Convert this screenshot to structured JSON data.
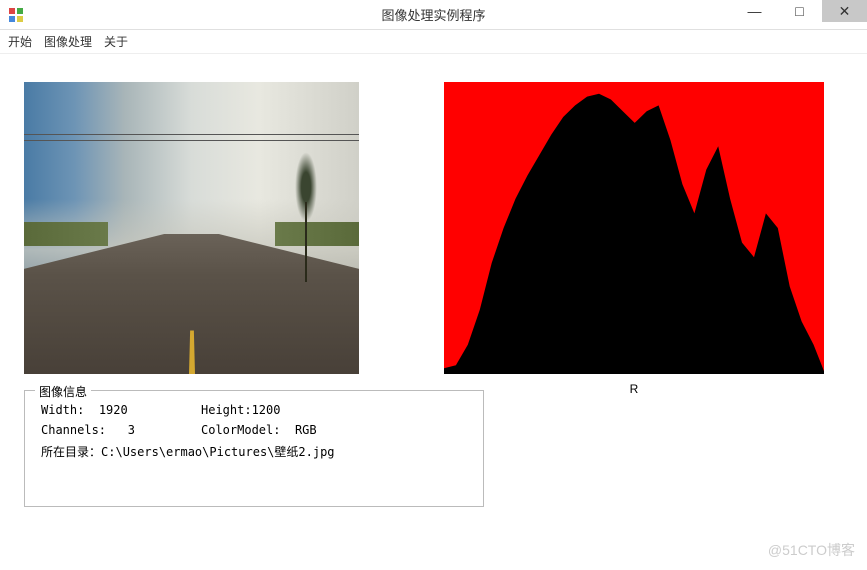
{
  "window": {
    "title": "图像处理实例程序",
    "controls": {
      "min": "—",
      "max": "□",
      "close": "✕"
    }
  },
  "menu": {
    "start": "开始",
    "imageProcess": "图像处理",
    "about": "关于"
  },
  "histogram": {
    "label": "R"
  },
  "info": {
    "legend": "图像信息",
    "widthLabel": "Width:",
    "widthValue": "1920",
    "heightLabel": "Height:",
    "heightValue": "1200",
    "channelsLabel": "Channels:",
    "channelsValue": "3",
    "colorModelLabel": "ColorModel:",
    "colorModelValue": "RGB",
    "dirLabel": "所在目录：",
    "dirValue": "C:\\Users\\ermao\\Pictures\\壁纸2.jpg"
  },
  "watermark": "@51CTO博客",
  "chart_data": {
    "type": "area",
    "title": "R",
    "xlabel": "",
    "ylabel": "",
    "xlim": [
      0,
      255
    ],
    "ylim": [
      0,
      1
    ],
    "x": [
      0,
      8,
      16,
      24,
      32,
      40,
      48,
      56,
      64,
      72,
      80,
      88,
      96,
      104,
      112,
      120,
      128,
      136,
      144,
      152,
      160,
      168,
      176,
      184,
      192,
      200,
      208,
      216,
      224,
      232,
      240,
      248,
      255
    ],
    "values": [
      0.98,
      0.97,
      0.9,
      0.78,
      0.62,
      0.5,
      0.4,
      0.32,
      0.25,
      0.18,
      0.12,
      0.08,
      0.05,
      0.04,
      0.06,
      0.1,
      0.14,
      0.1,
      0.08,
      0.2,
      0.35,
      0.45,
      0.3,
      0.22,
      0.4,
      0.55,
      0.6,
      0.45,
      0.5,
      0.7,
      0.82,
      0.9,
      0.99
    ],
    "color": "#ff0000",
    "background": "#000000",
    "orientation": "top-down"
  }
}
